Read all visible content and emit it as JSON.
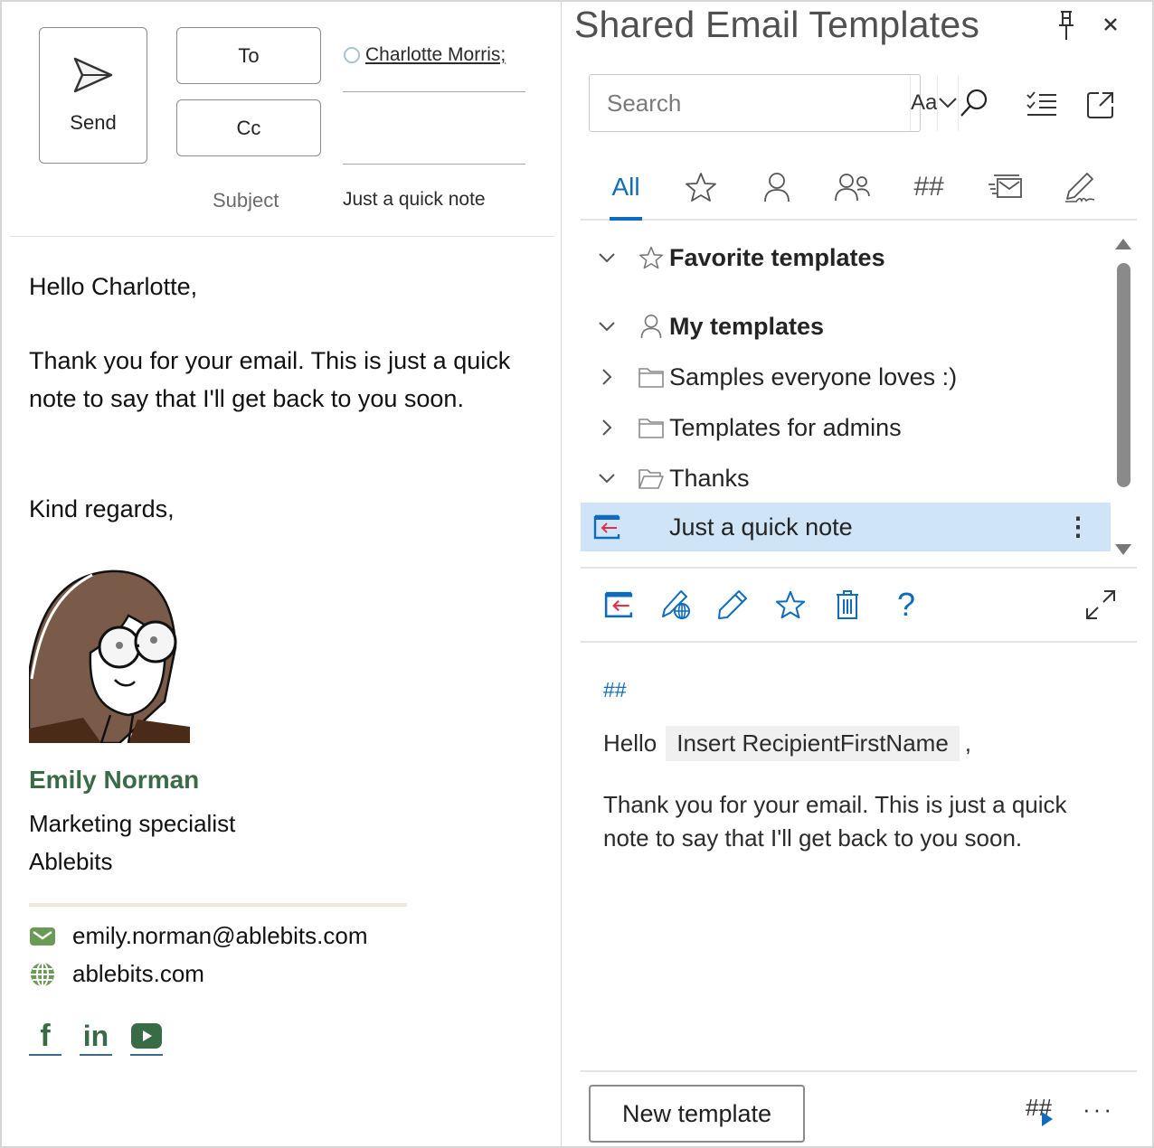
{
  "compose": {
    "send_label": "Send",
    "to_label": "To",
    "cc_label": "Cc",
    "to_recipient": "Charlotte Morris;",
    "cc_value": "",
    "subject_label": "Subject",
    "subject_value": "Just a quick note",
    "body": {
      "greeting": "Hello Charlotte,",
      "paragraph": "Thank you for your email. This is just a quick note to say that I'll get back to you soon.",
      "closing": "Kind regards,"
    },
    "signature": {
      "name": "Emily Norman",
      "title": "Marketing specialist",
      "company": "Ablebits",
      "email": "emily.norman@ablebits.com",
      "website": "ablebits.com",
      "social": [
        "facebook",
        "linkedin",
        "youtube"
      ],
      "accent_color": "#3a6b47",
      "icon_color": "#6a9a55"
    }
  },
  "pane": {
    "title": "Shared Email Templates",
    "search": {
      "placeholder": "Search",
      "match_case_label": "Aa"
    },
    "tabs": [
      {
        "label": "All",
        "icon": "all",
        "active": true
      },
      {
        "label": "",
        "icon": "star-icon"
      },
      {
        "label": "",
        "icon": "person-icon"
      },
      {
        "label": "",
        "icon": "people-icon"
      },
      {
        "label": "",
        "icon": "macros-icon"
      },
      {
        "label": "",
        "icon": "mail-fast-icon"
      },
      {
        "label": "",
        "icon": "signature-icon"
      }
    ],
    "tree": [
      {
        "label": "Favorite templates",
        "expanded": true,
        "icon": "star-icon",
        "level": 0
      },
      {
        "label": "My templates",
        "expanded": true,
        "icon": "person-icon",
        "level": 0
      },
      {
        "label": "Samples everyone loves :)",
        "expanded": false,
        "icon": "folder-icon",
        "level": 1
      },
      {
        "label": "Templates for admins",
        "expanded": false,
        "icon": "folder-icon",
        "level": 1
      },
      {
        "label": "Thanks",
        "expanded": true,
        "icon": "folder-open-icon",
        "level": 1
      },
      {
        "label": "Just a quick note",
        "icon": "insert-template-icon",
        "level": 2,
        "selected": true
      }
    ],
    "preview": {
      "hash": "##",
      "hello": "Hello",
      "macro": "Insert RecipientFirstName",
      "comma": ",",
      "body": "Thank you for your email. This is just a quick note to say that I'll get back to you soon."
    },
    "footer": {
      "new_template_label": "New template",
      "more_label": "···"
    },
    "accent_color": "#0f6cbd",
    "selected_color": "#cfe4f6"
  }
}
